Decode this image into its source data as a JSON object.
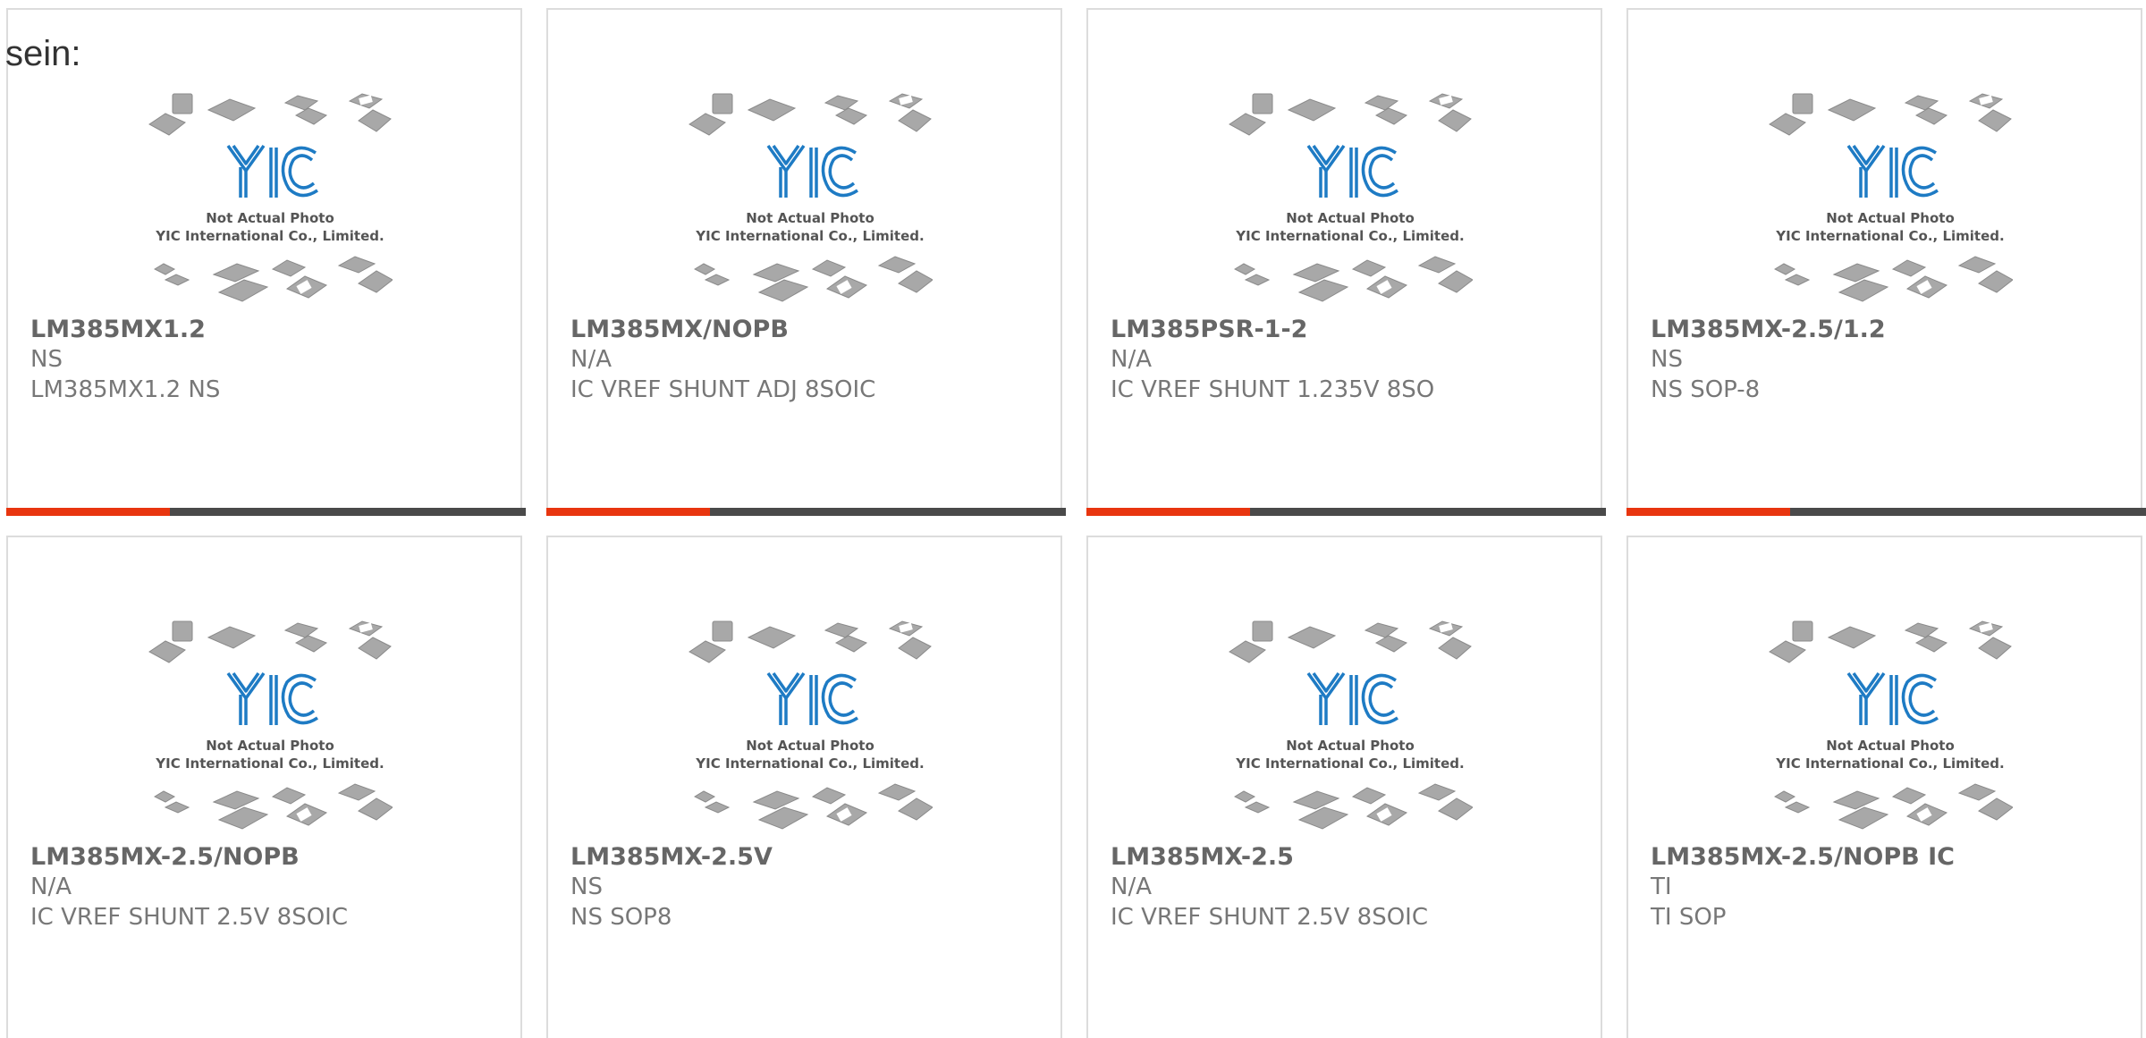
{
  "intro_text": "sein:",
  "placeholder": {
    "line1": "Not Actual Photo",
    "line2": "YIC International Co., Limited.",
    "logo_color": "#1e7bc4"
  },
  "colors": {
    "accent_bar": "#e8350f",
    "dark_bar": "#4a4a4a"
  },
  "products": [
    {
      "part": "LM385MX1.2",
      "brand": "NS",
      "desc": "LM385MX1.2 NS"
    },
    {
      "part": "LM385MX/NOPB",
      "brand": "N/A",
      "desc": "IC VREF SHUNT ADJ 8SOIC"
    },
    {
      "part": "LM385PSR-1-2",
      "brand": "N/A",
      "desc": "IC VREF SHUNT 1.235V 8SO"
    },
    {
      "part": "LM385MX-2.5/1.2",
      "brand": "NS",
      "desc": "NS SOP-8"
    },
    {
      "part": "LM385MX-2.5/NOPB",
      "brand": "N/A",
      "desc": "IC VREF SHUNT 2.5V 8SOIC"
    },
    {
      "part": "LM385MX-2.5V",
      "brand": "NS",
      "desc": "NS SOP8"
    },
    {
      "part": "LM385MX-2.5",
      "brand": "N/A",
      "desc": "IC VREF SHUNT 2.5V 8SOIC"
    },
    {
      "part": "LM385MX-2.5/NOPB IC",
      "brand": "TI",
      "desc": "TI SOP"
    }
  ]
}
